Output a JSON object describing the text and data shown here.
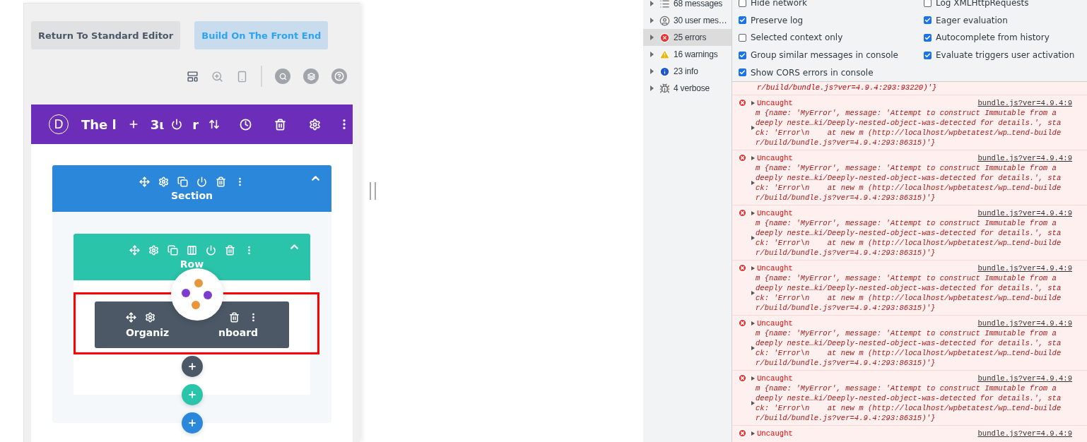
{
  "builder": {
    "buttons": [
      {
        "label": "Return To Standard Editor",
        "kind": "standard"
      },
      {
        "label": "Build On The Front End",
        "kind": "front"
      }
    ],
    "header": {
      "logo": "D",
      "title_fragments": [
        "The l",
        "3ι",
        "r"
      ]
    },
    "section": {
      "label": "Section"
    },
    "row": {
      "label": "Row"
    },
    "module": {
      "label_fragments": [
        "Organiz",
        "nboard"
      ]
    }
  },
  "devtools": {
    "sidebar": [
      {
        "kind": "messages",
        "label": "68 messages",
        "selected": false
      },
      {
        "kind": "user",
        "label": "30 user mes…",
        "selected": false
      },
      {
        "kind": "errors",
        "label": "25 errors",
        "selected": true
      },
      {
        "kind": "warnings",
        "label": "16 warnings",
        "selected": false
      },
      {
        "kind": "info",
        "label": "23 info",
        "selected": false
      },
      {
        "kind": "verbose",
        "label": "4 verbose",
        "selected": false
      }
    ],
    "settings_left": [
      {
        "label": "Hide network",
        "checked": false
      },
      {
        "label": "Preserve log",
        "checked": true
      },
      {
        "label": "Selected context only",
        "checked": false
      },
      {
        "label": "Group similar messages in console",
        "checked": true
      },
      {
        "label": "Show CORS errors in console",
        "checked": true
      }
    ],
    "settings_right": [
      {
        "label": "Log XMLHttpRequests",
        "checked": false
      },
      {
        "label": "Eager evaluation",
        "checked": true
      },
      {
        "label": "Autocomplete from history",
        "checked": true
      },
      {
        "label": "Evaluate triggers user activation",
        "checked": true
      }
    ],
    "console_tail": "r/build/bundle.js?ver=4.9.4:293:93220)'}",
    "messages": [
      {
        "title": "Uncaught",
        "source": "bundle.js?ver=4.9.4:9",
        "lines": [
          "m {name: 'MyError', message: 'Attempt to construct Immutable from a",
          "deeply neste…ki/Deeply-nested-object-was-detected for details.', sta",
          "ck: 'Error\\n    at new m (http://localhost/wpbetatest/wp…tend-builde",
          "r/build/bundle.js?ver=4.9.4:293:86315)'}"
        ]
      },
      {
        "title": "Uncaught",
        "source": "bundle.js?ver=4.9.4:9",
        "lines": [
          "m {name: 'MyError', message: 'Attempt to construct Immutable from a",
          "deeply neste…ki/Deeply-nested-object-was-detected for details.', sta",
          "ck: 'Error\\n    at new m (http://localhost/wpbetatest/wp…tend-builde",
          "r/build/bundle.js?ver=4.9.4:293:86315)'}"
        ]
      },
      {
        "title": "Uncaught",
        "source": "bundle.js?ver=4.9.4:9",
        "lines": [
          "m {name: 'MyError', message: 'Attempt to construct Immutable from a",
          "deeply neste…ki/Deeply-nested-object-was-detected for details.', sta",
          "ck: 'Error\\n    at new m (http://localhost/wpbetatest/wp…tend-builde",
          "r/build/bundle.js?ver=4.9.4:293:86315)'}"
        ]
      },
      {
        "title": "Uncaught",
        "source": "bundle.js?ver=4.9.4:9",
        "lines": [
          "m {name: 'MyError', message: 'Attempt to construct Immutable from a",
          "deeply neste…ki/Deeply-nested-object-was-detected for details.', sta",
          "ck: 'Error\\n    at new m (http://localhost/wpbetatest/wp…tend-builde",
          "r/build/bundle.js?ver=4.9.4:293:86315)'}"
        ]
      },
      {
        "title": "Uncaught",
        "source": "bundle.js?ver=4.9.4:9",
        "lines": [
          "m {name: 'MyError', message: 'Attempt to construct Immutable from a",
          "deeply neste…ki/Deeply-nested-object-was-detected for details.', sta",
          "ck: 'Error\\n    at new m (http://localhost/wpbetatest/wp…tend-builde",
          "r/build/bundle.js?ver=4.9.4:293:86315)'}"
        ]
      },
      {
        "title": "Uncaught",
        "source": "bundle.js?ver=4.9.4:9",
        "lines": [
          "m {name: 'MyError', message: 'Attempt to construct Immutable from a",
          "deeply neste…ki/Deeply-nested-object-was-detected for details.', sta",
          "ck: 'Error\\n    at new m (http://localhost/wpbetatest/wp…tend-builde",
          "r/build/bundle.js?ver=4.9.4:293:86315)'}"
        ]
      },
      {
        "title": "Uncaught",
        "source": "bundle.js?ver=4.9.4:9"
      }
    ]
  }
}
